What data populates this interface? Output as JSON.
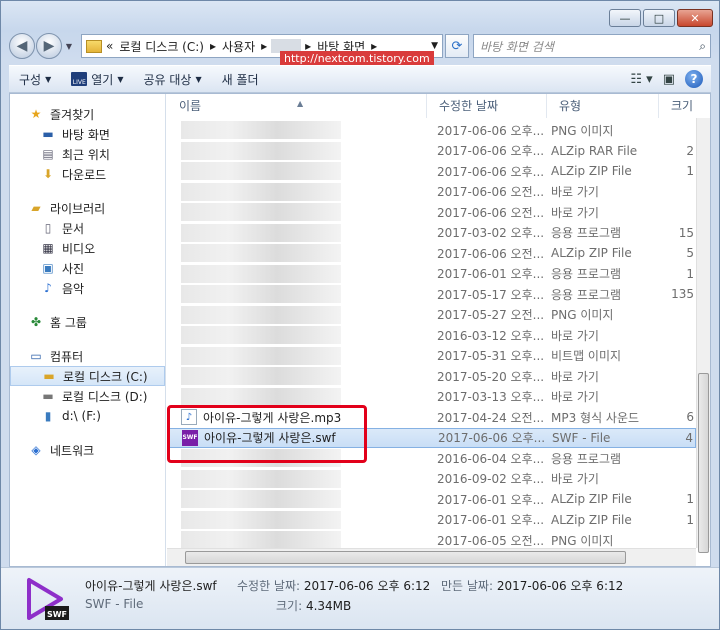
{
  "window": {
    "minimize": "—",
    "maximize": "□",
    "close": "✕"
  },
  "address": {
    "prefix": "«",
    "path": [
      "로컬 디스크 (C:)",
      "사용자",
      "바탕 화면"
    ],
    "sep": "▸"
  },
  "search": {
    "placeholder": "바탕 화면 검색"
  },
  "watermark": "http://nextcom.tistory.com",
  "toolbar": {
    "organize": "구성",
    "open": "열기",
    "share": "공유 대상",
    "new_folder": "새 폴더"
  },
  "nav": {
    "favorites": "즐겨찾기",
    "desktop": "바탕 화면",
    "recent": "최근 위치",
    "downloads": "다운로드",
    "libraries": "라이브러리",
    "documents": "문서",
    "videos": "비디오",
    "pictures": "사진",
    "music": "음악",
    "homegroup": "홈 그룹",
    "computer": "컴퓨터",
    "disk_c": "로컬 디스크 (C:)",
    "disk_d": "로컬 디스크 (D:)",
    "drive_f": "d:\\ (F:)",
    "network": "네트워크"
  },
  "columns": {
    "name": "이름",
    "modified": "수정한 날짜",
    "type": "유형",
    "size": "크기"
  },
  "rows": [
    {
      "date": "2017-06-06 오후...",
      "type": "PNG 이미지",
      "size": ""
    },
    {
      "date": "2017-06-06 오후...",
      "type": "ALZip RAR File",
      "size": "2"
    },
    {
      "date": "2017-06-06 오후...",
      "type": "ALZip ZIP File",
      "size": "1"
    },
    {
      "date": "2017-06-06 오전...",
      "type": "바로 가기",
      "size": ""
    },
    {
      "date": "2017-06-06 오전...",
      "type": "바로 가기",
      "size": ""
    },
    {
      "date": "2017-03-02 오후...",
      "type": "응용 프로그램",
      "size": "15"
    },
    {
      "date": "2017-06-06 오전...",
      "type": "ALZip ZIP File",
      "size": "5"
    },
    {
      "date": "2017-06-01 오후...",
      "type": "응용 프로그램",
      "size": "1"
    },
    {
      "date": "2017-05-17 오후...",
      "type": "응용 프로그램",
      "size": "135"
    },
    {
      "date": "2017-05-27 오전...",
      "type": "PNG 이미지",
      "size": ""
    },
    {
      "date": "2016-03-12 오후...",
      "type": "바로 가기",
      "size": ""
    },
    {
      "date": "2017-05-31 오후...",
      "type": "비트맵 이미지",
      "size": ""
    },
    {
      "date": "2017-05-20 오후...",
      "type": "바로 가기",
      "size": ""
    },
    {
      "date": "2017-03-13 오후...",
      "type": "바로 가기",
      "size": ""
    },
    {
      "name": "아이유-그렇게 사랑은.mp3",
      "icon": "mp3",
      "date": "2017-04-24 오전...",
      "type": "MP3 형식 사운드",
      "size": "6"
    },
    {
      "name": "아이유-그렇게 사랑은.swf",
      "icon": "swf",
      "date": "2017-06-06 오후...",
      "type": "SWF - File",
      "size": "4",
      "selected": true
    },
    {
      "date": "2016-06-04 오후...",
      "type": "응용 프로그램",
      "size": ""
    },
    {
      "date": "2016-09-02 오후...",
      "type": "바로 가기",
      "size": ""
    },
    {
      "date": "2017-06-01 오후...",
      "type": "ALZip ZIP File",
      "size": "1"
    },
    {
      "date": "2017-06-01 오후...",
      "type": "ALZip ZIP File",
      "size": "1"
    },
    {
      "date": "2017-06-05 오전...",
      "type": "PNG 이미지",
      "size": ""
    }
  ],
  "details": {
    "filename": "아이유-그렇게 사랑은.swf",
    "filetype": "SWF - File",
    "modified_label": "수정한 날짜:",
    "modified_value": "2017-06-06 오후 6:12",
    "created_label": "만든 날짜:",
    "created_value": "2017-06-06 오후 6:12",
    "size_label": "크기:",
    "size_value": "4.34MB"
  },
  "colors": {
    "highlight": "#e2001a",
    "swf": "#7a1fa8"
  }
}
